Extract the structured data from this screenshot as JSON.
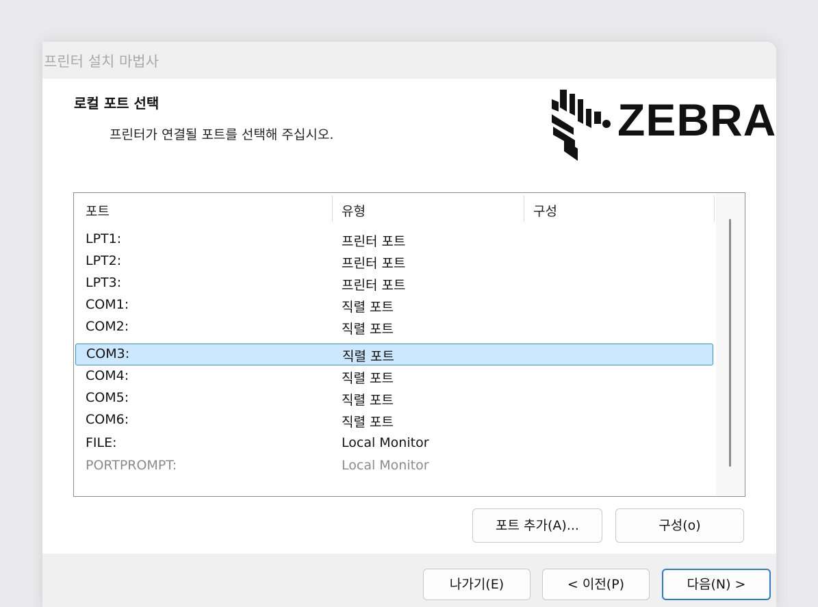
{
  "window": {
    "title": "프린터 설치 마법사"
  },
  "header": {
    "heading": "로컬 포트 선택",
    "subheading": "프린터가 연결될 포트를 선택해 주십시오.",
    "logo_text": "ZEBRA"
  },
  "port_list": {
    "columns": [
      "포트",
      "유형",
      "구성"
    ],
    "rows": [
      {
        "port": "LPT1:",
        "type": "프린터 포트"
      },
      {
        "port": "LPT2:",
        "type": "프린터 포트"
      },
      {
        "port": "LPT3:",
        "type": "프린터 포트"
      },
      {
        "port": "COM1:",
        "type": "직렬 포트"
      },
      {
        "port": "COM2:",
        "type": "직렬 포트"
      },
      {
        "port": "COM3:",
        "type": "직렬 포트"
      },
      {
        "port": "COM4:",
        "type": "직렬 포트"
      },
      {
        "port": "COM5:",
        "type": "직렬 포트"
      },
      {
        "port": "COM6:",
        "type": "직렬 포트"
      },
      {
        "port": "FILE:",
        "type": "Local Monitor"
      },
      {
        "port": "PORTPROMPT:",
        "type": "Local Monitor"
      }
    ],
    "selected_port": "COM3:"
  },
  "buttons": {
    "add_port": "포트 추가(A)...",
    "configure": "구성(o)",
    "exit": "나가기(E)",
    "back": "< 이전(P)",
    "next": "다음(N) >"
  },
  "colors": {
    "selection_fill": "#cce8ff",
    "selection_border": "#3c8fd6",
    "primary_button_border": "#2a7ad1"
  }
}
